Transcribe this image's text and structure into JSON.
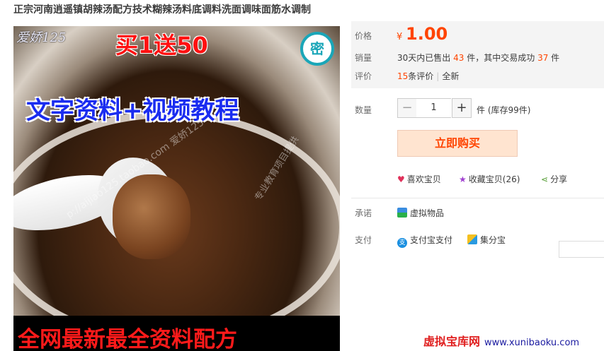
{
  "title": "正宗河南逍遥镇胡辣汤配方技术糊辣汤料底调料洗面调味面筋水调制",
  "image": {
    "watermark_top": "爱娇125",
    "promo": "买1送50",
    "badge": "密",
    "headline": "文字资料+视频教程",
    "watermark_diag": "p://aijiao125.taobao.com 爱娇125",
    "watermark_diag2": "专业教育项目提供",
    "bottom_text": "全网最新最全资料配方"
  },
  "price": {
    "label": "价格",
    "currency": "¥",
    "value": "1.00"
  },
  "sales": {
    "label": "销量",
    "prefix": "30天内已售出",
    "sold": "43",
    "mid": "件，其中交易成功",
    "success": "37",
    "suffix": "件"
  },
  "reviews": {
    "label": "评价",
    "count": "15",
    "count_suffix": "条评价",
    "all": "全新"
  },
  "quantity": {
    "label": "数量",
    "value": "1",
    "minus": "−",
    "plus": "+",
    "unit": "件 (库存99件)"
  },
  "buy_button": "立即购买",
  "social": {
    "like": "喜欢宝贝",
    "favorite": "收藏宝贝(26)",
    "share": "分享"
  },
  "promise": {
    "label": "承诺",
    "value": "虚拟物品"
  },
  "payment": {
    "label": "支付",
    "alipay": "支付宝支付",
    "jifen": "集分宝"
  },
  "footer_watermark": {
    "name": "虚拟宝库网",
    "site": "www.xunibaoku.com"
  },
  "colors": {
    "accent": "#ff4400",
    "buy_bg": "#ffe4d0",
    "headline": "#1a2cf0",
    "promo": "#ff1010"
  }
}
